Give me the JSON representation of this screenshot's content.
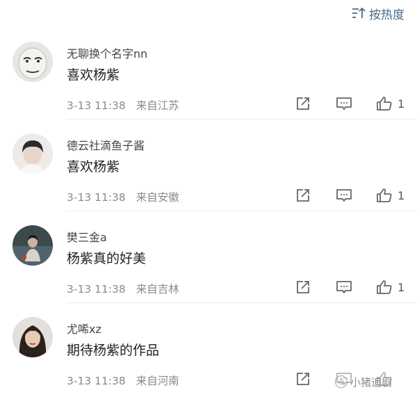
{
  "sort": {
    "label": "按热度",
    "icon": "sort-icon"
  },
  "comments": [
    {
      "username": "无聊换个名字nn",
      "content": "喜欢杨紫",
      "time": "3-13 11:38",
      "location": "来自江苏",
      "likes": "1",
      "avatar": "meme-face-avatar"
    },
    {
      "username": "德云社滴鱼子酱",
      "content": "喜欢杨紫",
      "time": "3-13 11:38",
      "location": "来自安徽",
      "likes": "1",
      "avatar": "person-avatar"
    },
    {
      "username": "樊三金a",
      "content": "杨紫真的好美",
      "time": "3-13 11:38",
      "location": "来自吉林",
      "likes": "1",
      "avatar": "person-avatar"
    },
    {
      "username": "尤唏xz",
      "content": "期待杨紫的作品",
      "time": "3-13 11:38",
      "location": "来自河南",
      "likes": "",
      "avatar": "person-avatar"
    }
  ],
  "watermark": {
    "text": "小猪追剧"
  },
  "colors": {
    "link": "#4a6b8a",
    "meta": "#8a8a8a",
    "icon": "#666666",
    "divider": "#ececec"
  }
}
